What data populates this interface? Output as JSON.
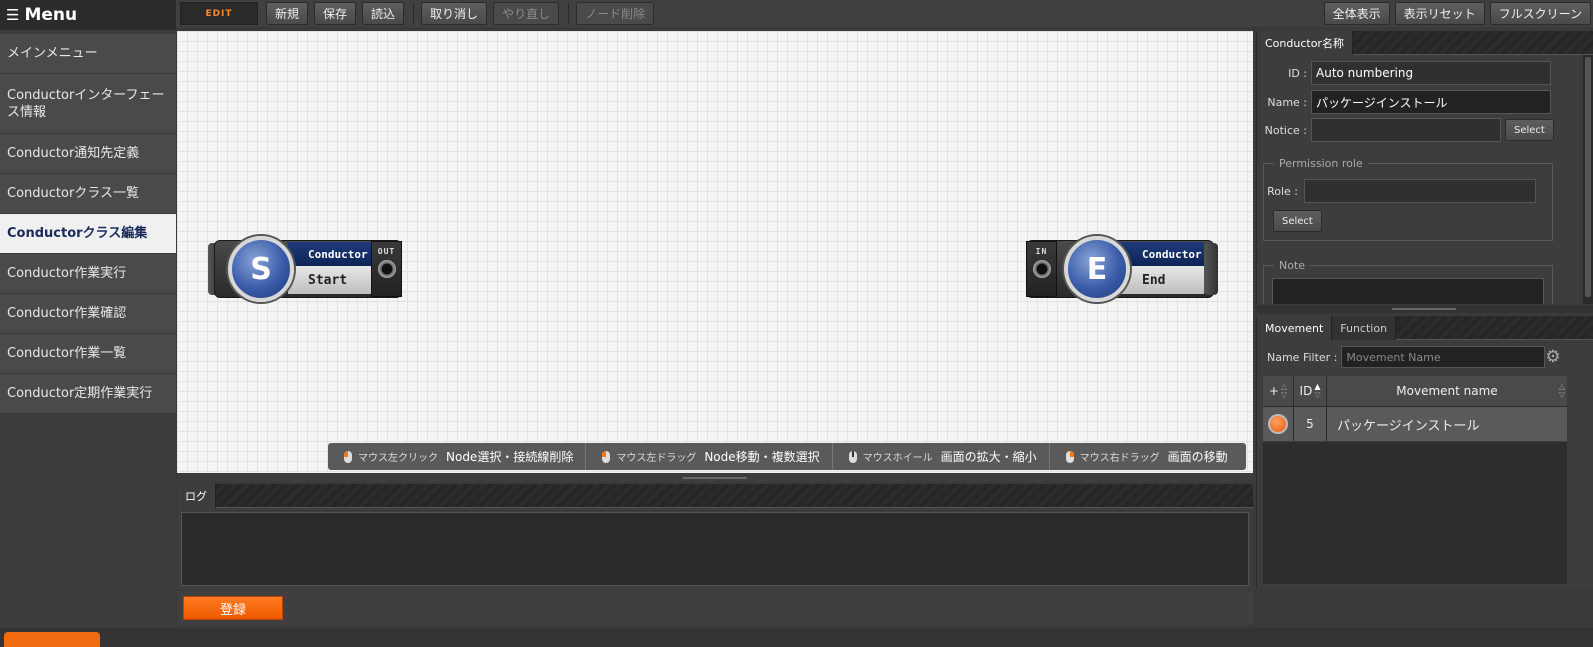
{
  "sidebar": {
    "title": "Menu",
    "items": [
      {
        "label": "メインメニュー"
      },
      {
        "label": "Conductorインターフェース情報"
      },
      {
        "label": "Conductor通知先定義"
      },
      {
        "label": "Conductorクラス一覧"
      },
      {
        "label": "Conductorクラス編集"
      },
      {
        "label": "Conductor作業実行"
      },
      {
        "label": "Conductor作業確認"
      },
      {
        "label": "Conductor作業一覧"
      },
      {
        "label": "Conductor定期作業実行"
      }
    ]
  },
  "toolbar": {
    "mode": "EDIT",
    "new": "新規",
    "save": "保存",
    "load": "読込",
    "undo": "取り消し",
    "redo": "やり直し",
    "delete_node": "ノード削除",
    "show_all": "全体表示",
    "reset_view": "表示リセット",
    "fullscreen": "フルスクリーン"
  },
  "canvas": {
    "start_node": {
      "letter": "S",
      "type": "Conductor",
      "label": "Start",
      "terminal": "OUT"
    },
    "end_node": {
      "letter": "E",
      "type": "Conductor",
      "label": "End",
      "terminal": "IN"
    },
    "hints": [
      {
        "action": "マウス左クリック",
        "desc": "Node選択・接続線削除"
      },
      {
        "action": "マウス左ドラッグ",
        "desc": "Node移動・複数選択"
      },
      {
        "action": "マウスホイール",
        "desc": "画面の拡大・縮小"
      },
      {
        "action": "マウス右ドラッグ",
        "desc": "画面の移動"
      }
    ]
  },
  "log": {
    "tab": "ログ"
  },
  "register_label": "登録",
  "properties": {
    "tab": "Conductor名称",
    "id_label": "ID :",
    "id_value": "Auto numbering",
    "name_label": "Name :",
    "name_value": "パッケージインストール",
    "notice_label": "Notice :",
    "notice_select": "Select",
    "permission_legend": "Permission role",
    "role_label": "Role :",
    "role_select": "Select",
    "note_legend": "Note"
  },
  "movement": {
    "tabs": [
      "Movement",
      "Function"
    ],
    "filter_label": "Name Filter :",
    "filter_placeholder": "Movement Name",
    "columns": {
      "add": "+",
      "id": "ID",
      "name": "Movement name"
    },
    "rows": [
      {
        "id": "5",
        "name": "パッケージインストール"
      }
    ]
  },
  "colors": {
    "accent_orange": "#f06a10",
    "node_blue": "#1e3a7a",
    "active_menu_bg": "#f0f0f0"
  }
}
